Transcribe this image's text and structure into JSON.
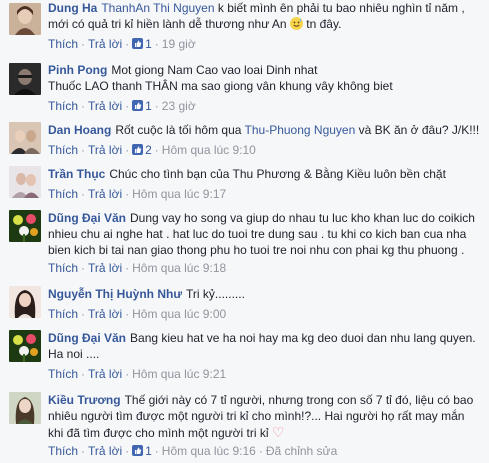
{
  "action_labels": {
    "like": "Thích",
    "reply": "Trả lời",
    "separator": "·"
  },
  "comments": [
    {
      "author": "Dung Ha",
      "mention": "ThanhAn Thi Nguyen",
      "text_line1": " k biết mình ên phải tu bao nhiêu nghìn tỉ năm ,",
      "text_line2": "mới có quả tri kỉ hiền lành dễ thương như An",
      "emoji": "sweat-smile-emoji",
      "text_after_emoji": " tn đây.",
      "like_count": "1",
      "time": "19 giờ",
      "avatar_colors": [
        "#c9b19a",
        "#6b4a3a"
      ]
    },
    {
      "author": "Pinh Pong",
      "text_line1": "Mot giong Nam Cao vao loai Dinh nhat",
      "text_line2": "Thuốc LAO thanh THÂN ma sao giong vân khung vây không biet",
      "like_count": "1",
      "time": "23 giờ",
      "avatar_colors": [
        "#2a2a2a",
        "#5a5a5a"
      ]
    },
    {
      "author": "Dan Hoang",
      "text_line1": "Rốt cuộc là tối hôm qua ",
      "mention": "Thu-Phuong Nguyen",
      "text_after_mention": " và BK ăn ở đâu? J/K!!!",
      "like_count": "2",
      "time": "Hôm qua lúc 9:10",
      "avatar_colors": [
        "#d9c5b4",
        "#7a6a60"
      ]
    },
    {
      "author": "Trần Thục",
      "text_line1": "Chúc cho tình bạn của Thu Phương & Bằng Kiều luôn bền chặt",
      "like_count": "",
      "time": "Hôm qua lúc 9:17",
      "avatar_colors": [
        "#e8e4e8",
        "#b0a0a8"
      ]
    },
    {
      "author": "Dũng Đại Văn",
      "text_line1": "Dung vay ho song va giup do nhau tu luc kho khan luc do coikich",
      "text_line2": "nhieu chu ai nghe hat . hat luc do tuoi tre dung sau . tu khi co kich ban cua nha",
      "text_line3": "bien kich bi tai nan giao thong phu ho tuoi tre noi nhu con phai kg thu phuong .",
      "like_count": "",
      "time": "Hôm qua lúc 9:18",
      "avatar_colors": [
        "#1e3a12",
        "#d8e04a"
      ]
    },
    {
      "author": "Nguyễn Thị Huỳnh Như",
      "text_line1": "Tri kỷ.........",
      "like_count": "",
      "time": "Hôm qua lúc 9:00",
      "avatar_colors": [
        "#f2e6e0",
        "#2b1d1a"
      ]
    },
    {
      "author": "Dũng Đại Văn",
      "text_line1": "Bang kieu hat ve ha noi hay ma kg deo duoi dan nhu lang quyen.",
      "text_line2": "Ha noi ....",
      "like_count": "",
      "time": "Hôm qua lúc 9:21",
      "avatar_colors": [
        "#1e3a12",
        "#d8e04a"
      ]
    },
    {
      "author": "Kiều Trương",
      "text_line1": "Thế giới này có 7 tỉ người, nhưng trong con số 7 tỉ đó, liệu có bao",
      "text_line2": "nhiêu người tìm được một người tri kỉ cho mình!?... Hai người họ rất may mắn",
      "text_line3": "khi đã tìm được cho mình một người tri kỉ",
      "heart": "♡",
      "like_count": "1",
      "time": "Hôm qua lúc 9:16",
      "edited": "Đã chỉnh sửa",
      "avatar_colors": [
        "#cfd6c4",
        "#4b5a3a"
      ]
    }
  ]
}
